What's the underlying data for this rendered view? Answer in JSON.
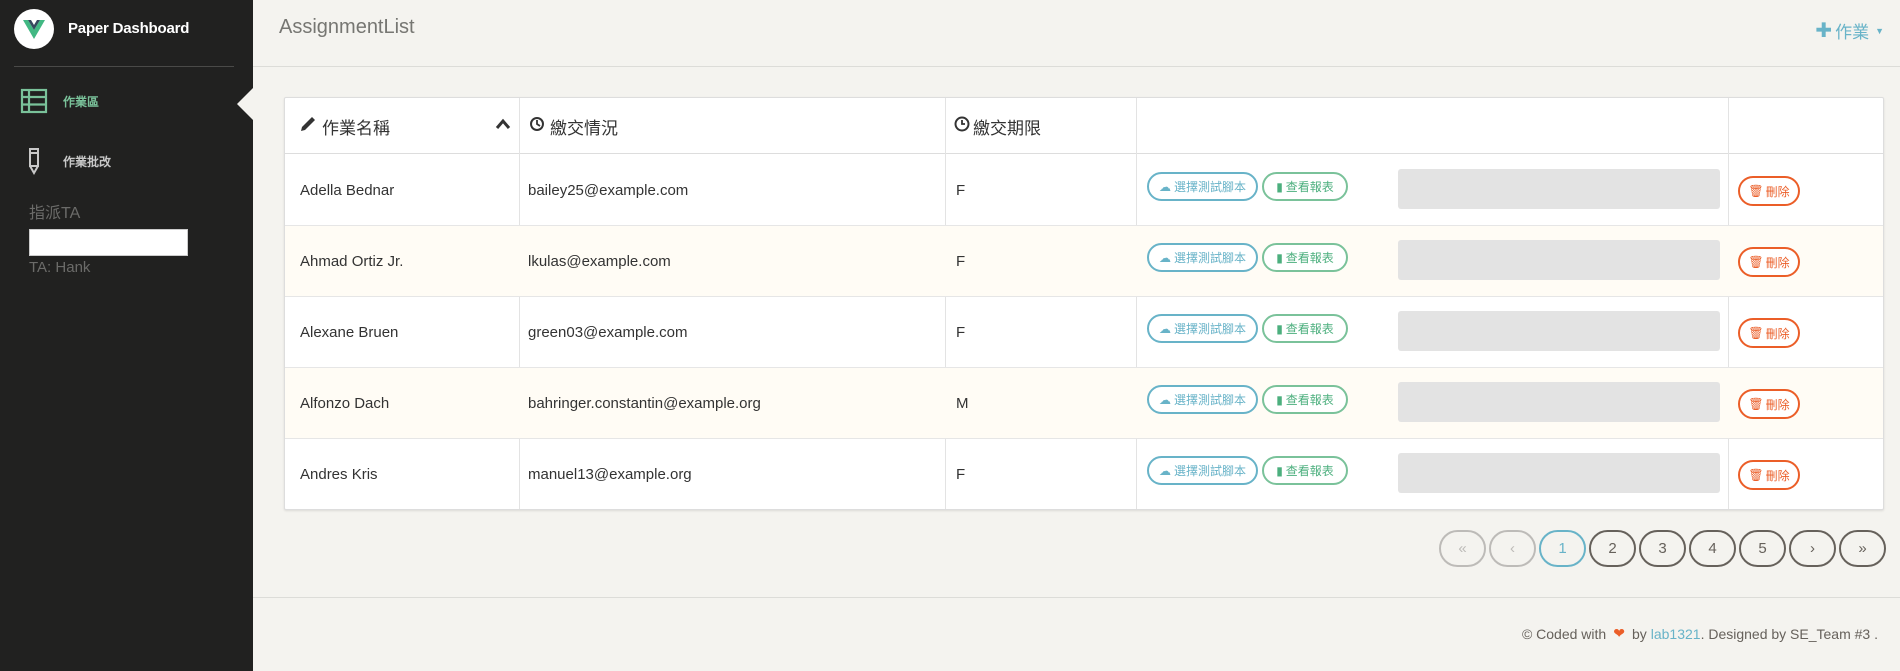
{
  "sidebar": {
    "brand": "Paper Dashboard",
    "items": [
      {
        "label": "作業區",
        "icon": "list-icon"
      },
      {
        "label": "作業批改",
        "icon": "pen-icon"
      }
    ],
    "ta_label": "指派TA",
    "ta_input_value": "",
    "ta_current": "TA: Hank"
  },
  "header": {
    "title": "AssignmentList",
    "add_label": "作業"
  },
  "table": {
    "headers": [
      "作業名稱",
      "繳交情況",
      "繳交期限"
    ],
    "script_button": "選擇測試腳本",
    "report_button": "查看報表",
    "delete_button": "刪除",
    "rows": [
      {
        "name": "Adella Bednar",
        "status": "bailey25@example.com",
        "deadline": "F"
      },
      {
        "name": "Ahmad Ortiz Jr.",
        "status": "lkulas@example.com",
        "deadline": "F"
      },
      {
        "name": "Alexane Bruen",
        "status": "green03@example.com",
        "deadline": "F"
      },
      {
        "name": "Alfonzo Dach",
        "status": "bahringer.constantin@example.org",
        "deadline": "M"
      },
      {
        "name": "Andres Kris",
        "status": "manuel13@example.org",
        "deadline": "F"
      }
    ]
  },
  "pagination": {
    "first": "«",
    "prev": "‹",
    "pages": [
      "1",
      "2",
      "3",
      "4",
      "5"
    ],
    "active_page": "1",
    "next": "›",
    "last": "»"
  },
  "footer": {
    "prefix": "© Coded with",
    "by": "by",
    "author": "lab1321",
    "suffix": ". Designed by SE_Team #3 ."
  },
  "colors": {
    "sidebar_bg": "#212120",
    "active_green": "#7ac29a",
    "info_blue": "#68b3c8",
    "danger": "#eb5e28"
  }
}
